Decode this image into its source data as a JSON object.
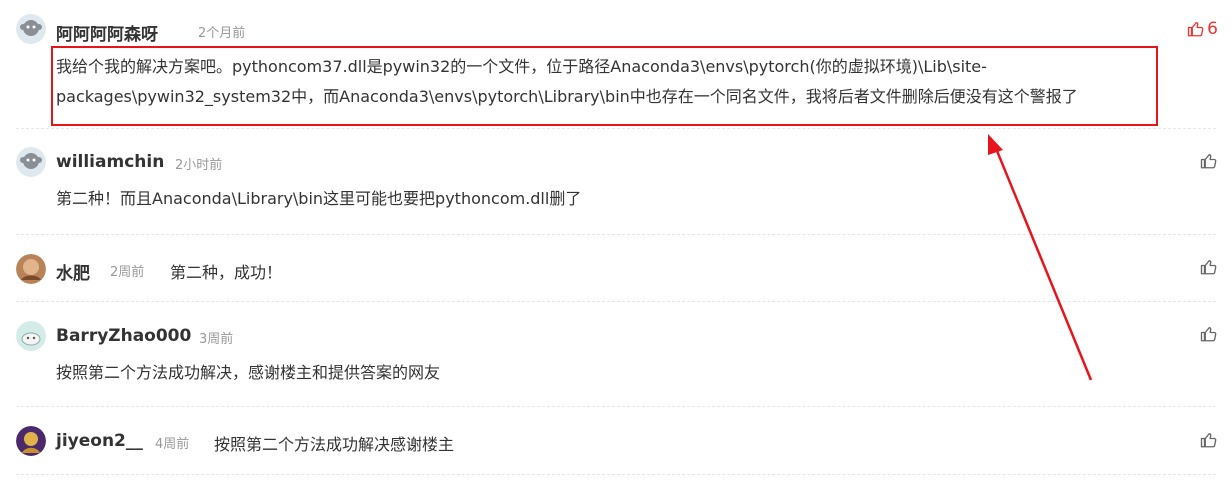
{
  "comments": [
    {
      "author": "阿阿阿阿森呀",
      "time": "2个月前",
      "lines": [
        "我给个我的解决方案吧。pythoncom37.dll是pywin32的一个文件，位于路径Anaconda3\\envs\\pytorch(你的虚拟环境)\\Lib\\site-",
        "packages\\pywin32_system32中，而Anaconda3\\envs\\pytorch\\Library\\bin中也存在一个同名文件，我将后者文件删除后便没有这个警报了"
      ],
      "likes": "6",
      "liked": true
    },
    {
      "author": "williamchin",
      "time": "2小时前",
      "lines": [
        "第二种！而且Anaconda\\Library\\bin这里可能也要把pythoncom.dll删了"
      ]
    },
    {
      "author": "水肥",
      "time": "2周前",
      "inline_text": "第二种，成功！"
    },
    {
      "author": "BarryZhao000",
      "time": "3周前",
      "lines": [
        "按照第二个方法成功解决，感谢楼主和提供答案的网友"
      ]
    },
    {
      "author": "jiyeon2__",
      "time": "4周前",
      "inline_text": "按照第二个方法成功解决感谢楼主"
    }
  ],
  "colors": {
    "accent_red": "#e8141b",
    "like_active": "#e33333",
    "muted_text": "#999999"
  },
  "icons": {
    "like": "thumbs-up-icon",
    "avatar": "avatar-icon",
    "annotation_arrow": "arrow-icon"
  }
}
